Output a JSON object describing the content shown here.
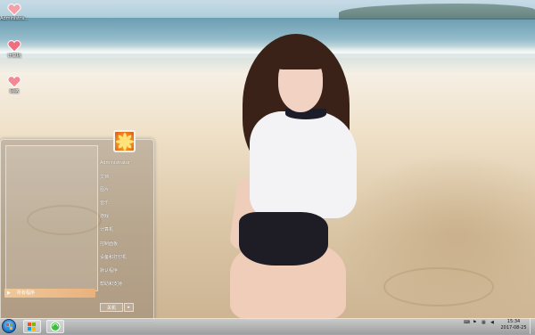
{
  "desktop": {
    "icons": [
      {
        "label": "Administra...",
        "icon": "heart-icon"
      },
      {
        "label": "计算机",
        "icon": "heart-icon"
      },
      {
        "label": "网络",
        "icon": "heart-icon"
      }
    ]
  },
  "start_menu": {
    "all_programs_label": "所有程序",
    "all_programs_arrow": "▶",
    "right_items": [
      "Administrator",
      "文档",
      "图片",
      "音乐",
      "游戏",
      "计算机",
      "控制面板",
      "设备和打印机",
      "默认程序",
      "帮助和支持"
    ],
    "shutdown_label": "关机",
    "shutdown_arrow": "▸"
  },
  "taskbar": {
    "tray_icons": [
      "speaker-icon",
      "network-icon",
      "flag-icon",
      "keyboard-icon"
    ],
    "time": "15:34",
    "date": "2017-08-25"
  },
  "colors": {
    "accent": "#e9b27d",
    "taskbar": "#a0a5aa"
  }
}
